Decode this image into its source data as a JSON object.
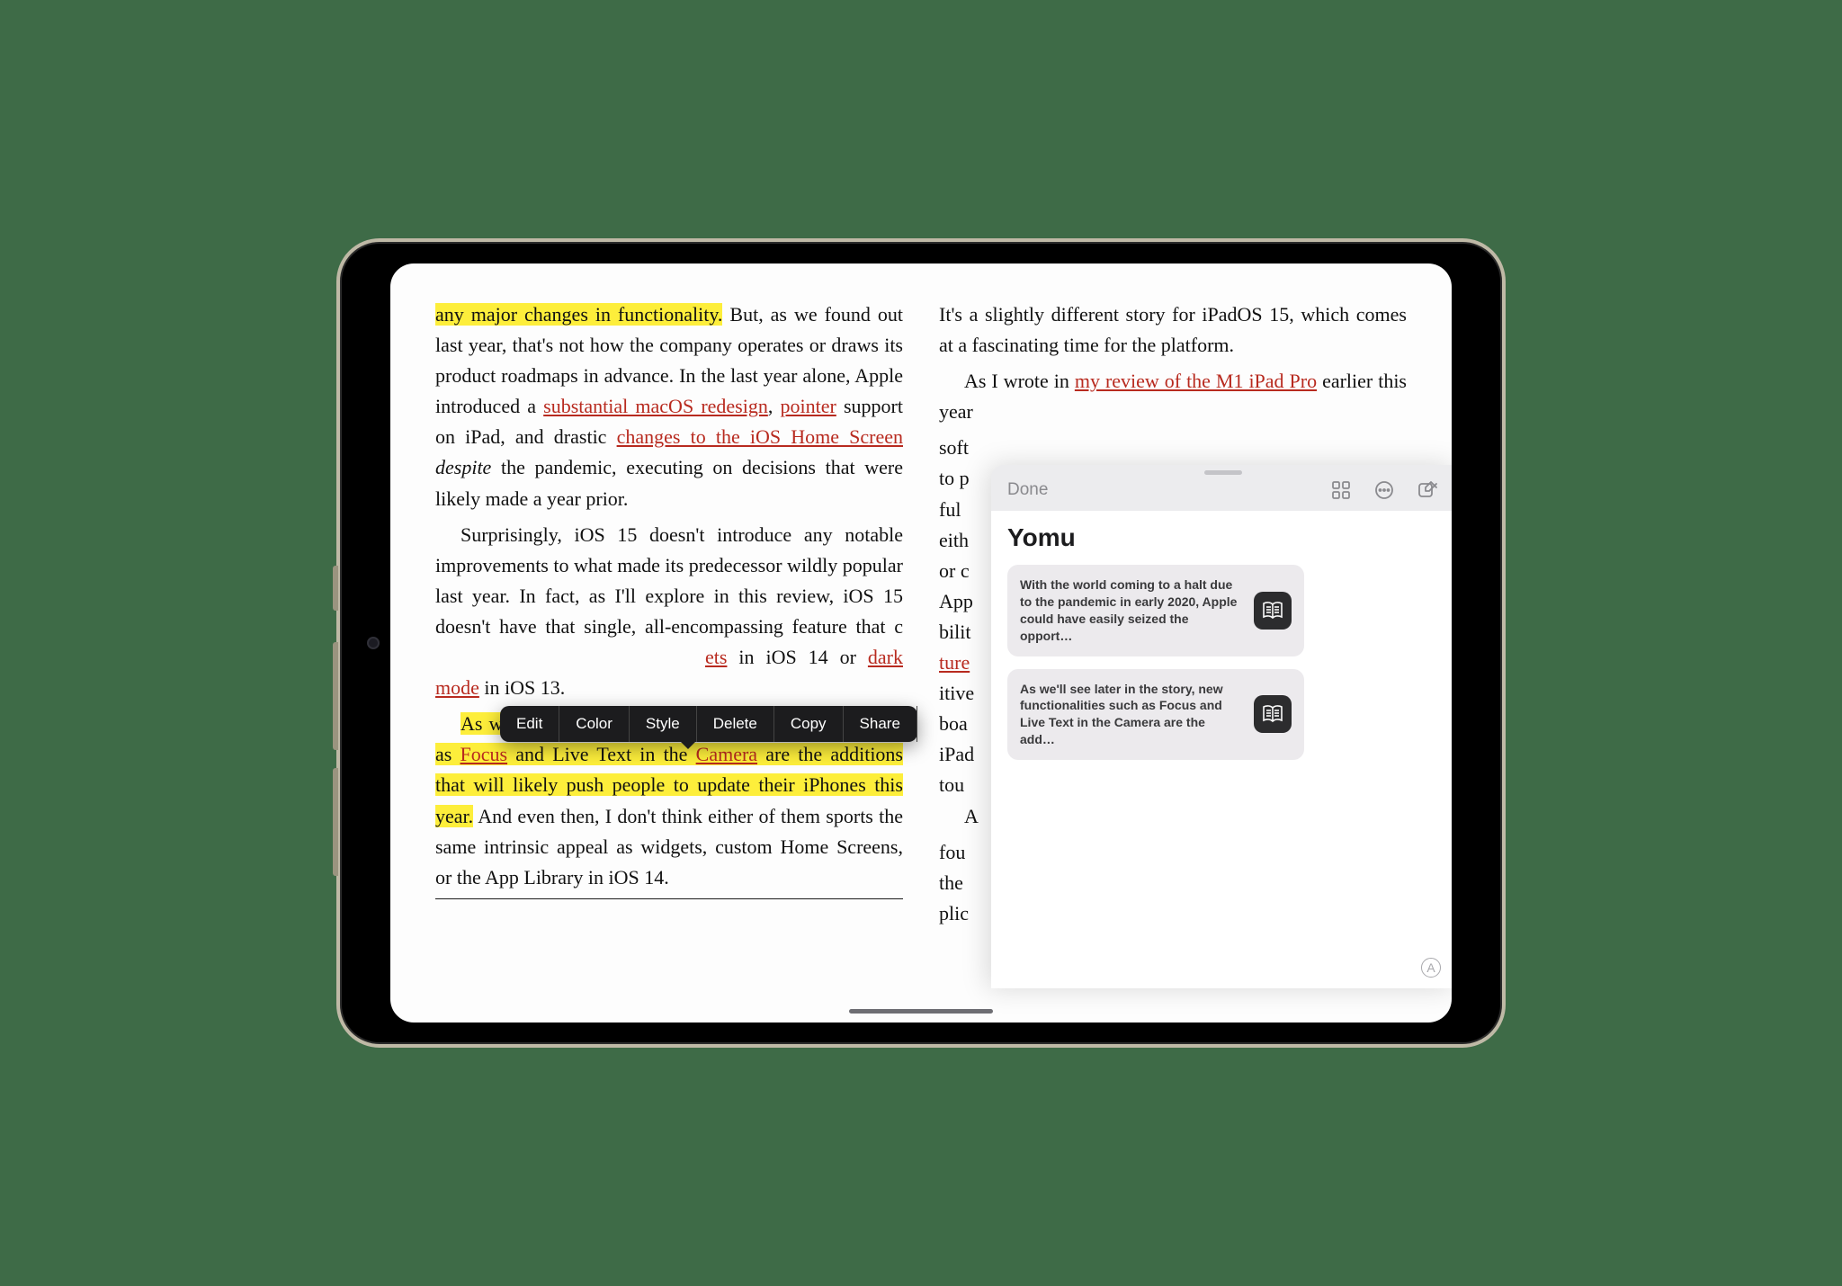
{
  "context_menu": {
    "items": [
      "Edit",
      "Color",
      "Style",
      "Delete",
      "Copy",
      "Share"
    ]
  },
  "article": {
    "col1": {
      "p1a_hl": "any major changes in functionality.",
      "p1b": " But, as we found out last year, that's not how the company operates or draws its product roadmaps in advance. In the last year alone, Apple introduced a ",
      "link_macos": "substantial macOS redesign",
      "p1c": ", ",
      "link_pointer": "pointer",
      "p1d": " support on iPad, and drastic ",
      "link_home": "changes to the iOS Home Screen",
      "p1e": " ",
      "p1e_ital": "despite",
      "p1f": " the pandemic, executing on decisions that were likely made a year prior.",
      "p2": "Surprisingly, iOS 15 doesn't introduce any notable improvements to what made its predecessor wildly popular last year. In fact, as I'll explore in this review, iOS 15 doesn't have that single, all-encompassing feature that ",
      "p2_cutoff": "c",
      "link_widgets_tail": "ets",
      "p2b": " in iOS 14 or ",
      "link_darkmode": "dark mode",
      "p2c": " in iOS 13.",
      "p3_hl_a": "As we'll see later in the story, new functionalities such as ",
      "link_focus": "Focus",
      "p3_hl_b": " and Live Text in the ",
      "link_camera": "Camera",
      "p3_hl_c": " are the additions that will likely push people to update their iPhones this year.",
      "p3d": " And even then, I don't think either of them sports the same intrinsic appeal as widgets, custom Home Screens, or the App Library in iOS 14."
    },
    "col2": {
      "p1": "It's a slightly different story for iPadOS 15, which comes at a fascinating time for the platform.",
      "p2a": "As I wrote in ",
      "link_m1": "my review of the M1 iPad Pro",
      "p2b": " earlier this year",
      "frag_lines": [
        "soft",
        "to p",
        "ful ",
        "eith",
        "or c",
        "App",
        "bilit",
        "ture",
        "itive",
        "boa",
        "iPad",
        "tou"
      ],
      "p3_frag": "A",
      "frag_lines2": [
        "fou",
        "the",
        "plic"
      ]
    }
  },
  "quicknote": {
    "done": "Done",
    "title": "Yomu",
    "cards": [
      "With the world coming to a halt due to the pandemic in early 2020, Apple could have easily seized the opport…",
      "As we'll see later in the story, new functionalities such as Focus and Live Text in the Camera are the add…"
    ],
    "marker": "A"
  }
}
